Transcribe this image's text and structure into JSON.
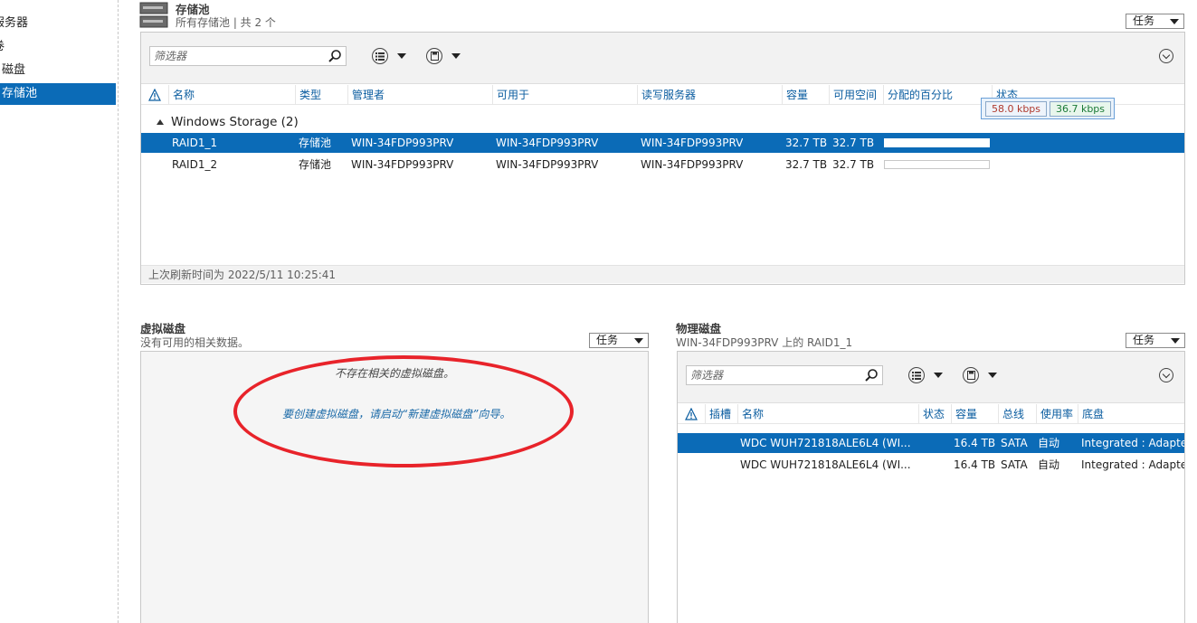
{
  "nav": {
    "items": [
      {
        "label": "服务器",
        "selected": false
      },
      {
        "label": "卷",
        "selected": false
      },
      {
        "label": "磁盘",
        "selected": false
      },
      {
        "label": "存储池",
        "selected": true
      }
    ]
  },
  "storage_pools": {
    "title": "存储池",
    "subtitle": "所有存储池 | 共 2 个",
    "tasks_label": "任务",
    "filter_placeholder": "筛选器",
    "columns": [
      "名称",
      "类型",
      "管理者",
      "可用于",
      "读写服务器",
      "容量",
      "可用空间",
      "分配的百分比",
      "状态"
    ],
    "group_label": "Windows Storage (2)",
    "rows": [
      {
        "name": "RAID1_1",
        "type": "存储池",
        "managed_by": "WIN-34FDP993PRV",
        "available_to": "WIN-34FDP993PRV",
        "rw_server": "WIN-34FDP993PRV",
        "capacity": "32.7 TB",
        "free_space": "32.7 TB",
        "allocated_fraction": 0,
        "selected": true
      },
      {
        "name": "RAID1_2",
        "type": "存储池",
        "managed_by": "WIN-34FDP993PRV",
        "available_to": "WIN-34FDP993PRV",
        "rw_server": "WIN-34FDP993PRV",
        "capacity": "32.7 TB",
        "free_space": "32.7 TB",
        "allocated_fraction": 0,
        "selected": false
      }
    ],
    "last_refresh": "上次刷新时间为 2022/5/11 10:25:41"
  },
  "net_meter": {
    "down": "58.0 kbps",
    "up": "36.7 kbps",
    "down_color": "#c0392b",
    "up_color": "#1a8a3a"
  },
  "virtual_disks": {
    "title": "虚拟磁盘",
    "subtitle": "没有可用的相关数据。",
    "tasks_label": "任务",
    "empty_message": "不存在相关的虚拟磁盘。",
    "hint_message": "要创建虚拟磁盘，请启动“新建虚拟磁盘”向导。"
  },
  "physical_disks": {
    "title": "物理磁盘",
    "subtitle": "WIN-34FDP993PRV 上的 RAID1_1",
    "tasks_label": "任务",
    "filter_placeholder": "筛选器",
    "columns": [
      "插槽",
      "名称",
      "状态",
      "容量",
      "总线",
      "使用率",
      "底盘"
    ],
    "rows": [
      {
        "slot": "",
        "name": "WDC  WUH721818ALE6L4 (WI...",
        "status": "",
        "capacity": "16.4 TB",
        "bus": "SATA",
        "usage": "自动",
        "chassis": "Integrated : Adapter",
        "selected": true
      },
      {
        "slot": "",
        "name": "WDC  WUH721818ALE6L4 (WI...",
        "status": "",
        "capacity": "16.4 TB",
        "bus": "SATA",
        "usage": "自动",
        "chassis": "Integrated : Adapter",
        "selected": false
      }
    ]
  },
  "colors": {
    "accent": "#0b6bb7",
    "header_link": "#0b5da0",
    "annotation": "#e8232a",
    "hint_text": "#1b6aa8"
  }
}
